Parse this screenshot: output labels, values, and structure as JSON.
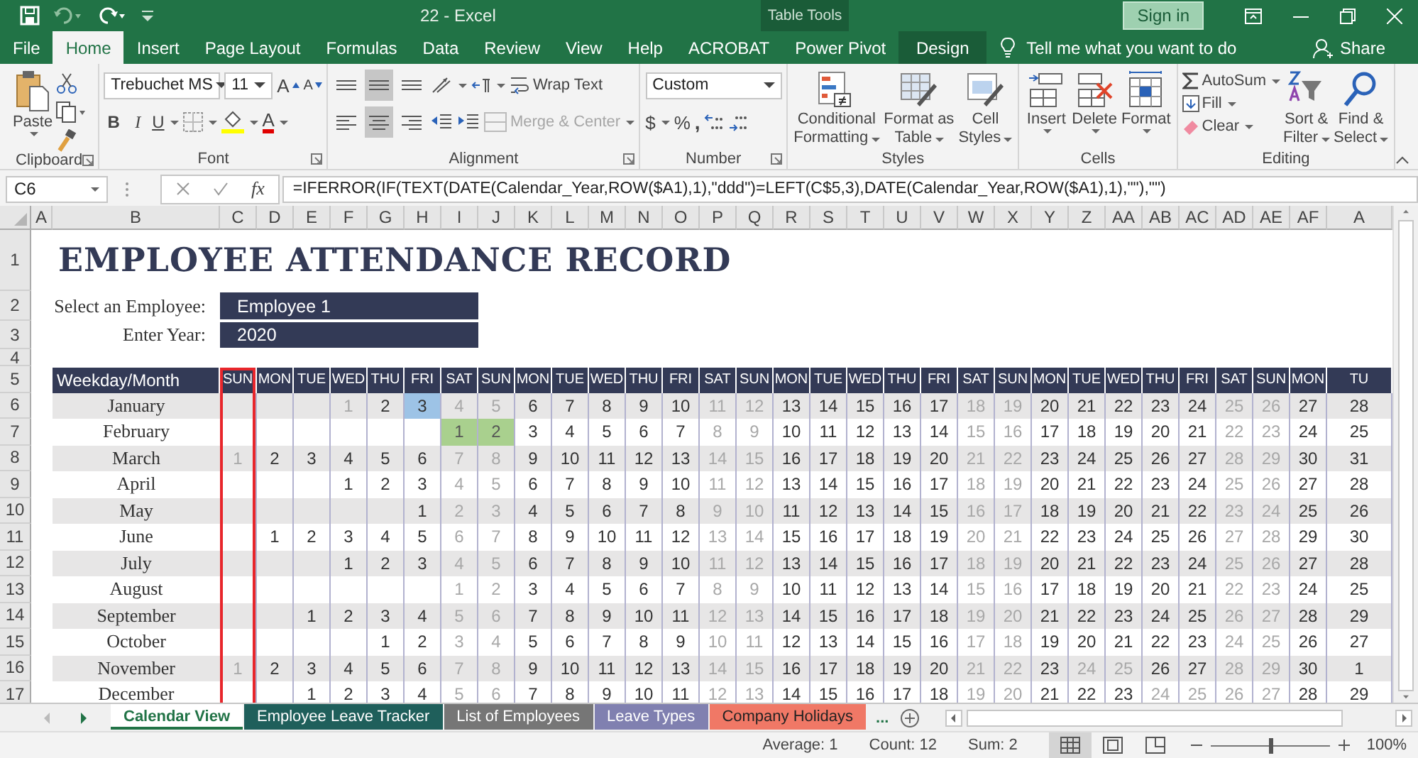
{
  "title_bar": {
    "title": "22  -  Excel",
    "context_label": "Table Tools",
    "sign_in": "Sign in"
  },
  "ribbon_tabs": [
    {
      "label": "File",
      "selected": false,
      "kind": "normal"
    },
    {
      "label": "Home",
      "selected": true,
      "kind": "normal"
    },
    {
      "label": "Insert",
      "selected": false,
      "kind": "normal"
    },
    {
      "label": "Page Layout",
      "selected": false,
      "kind": "normal"
    },
    {
      "label": "Formulas",
      "selected": false,
      "kind": "normal"
    },
    {
      "label": "Data",
      "selected": false,
      "kind": "normal"
    },
    {
      "label": "Review",
      "selected": false,
      "kind": "normal"
    },
    {
      "label": "View",
      "selected": false,
      "kind": "normal"
    },
    {
      "label": "Help",
      "selected": false,
      "kind": "normal"
    },
    {
      "label": "ACROBAT",
      "selected": false,
      "kind": "normal"
    },
    {
      "label": "Power Pivot",
      "selected": false,
      "kind": "normal"
    },
    {
      "label": "Design",
      "selected": false,
      "kind": "contextual"
    }
  ],
  "tell_me": "Tell me what you want to do",
  "share": "Share",
  "clipboard": {
    "label": "Clipboard",
    "paste": "Paste"
  },
  "font": {
    "label": "Font",
    "name": "Trebuchet MS",
    "size": "11",
    "grow": "A",
    "shrink": "A",
    "bold": "B",
    "italic": "I",
    "underline": "U",
    "color_letter": "A"
  },
  "alignment": {
    "label": "Alignment",
    "wrap_text": "Wrap Text",
    "merge": "Merge & Center",
    "merge_disabled": true,
    "buttons": [
      {
        "kind": "top",
        "selected": false
      },
      {
        "kind": "middle",
        "selected": true
      },
      {
        "kind": "bottom",
        "selected": false
      },
      {
        "kind": "left",
        "selected": false
      },
      {
        "kind": "center",
        "selected": true
      },
      {
        "kind": "right",
        "selected": false
      }
    ]
  },
  "number": {
    "label": "Number",
    "format": "Custom",
    "currency": "$",
    "percent": "%",
    "comma": ","
  },
  "styles": {
    "label": "Styles",
    "buttons": [
      {
        "kind": "conditional",
        "lines": [
          "Conditional",
          "Formatting"
        ]
      },
      {
        "kind": "table",
        "lines": [
          "Format as",
          "Table"
        ]
      },
      {
        "kind": "cell",
        "lines": [
          "Cell",
          "Styles"
        ]
      }
    ]
  },
  "cells": {
    "label": "Cells",
    "buttons": [
      {
        "kind": "insert",
        "label": "Insert"
      },
      {
        "kind": "delete",
        "label": "Delete"
      },
      {
        "kind": "format",
        "label": "Format"
      }
    ]
  },
  "editing": {
    "label": "Editing",
    "autosum": "AutoSum",
    "fill": "Fill",
    "clear": "Clear",
    "buttons": [
      {
        "kind": "sort",
        "lines": [
          "Sort &",
          "Filter"
        ]
      },
      {
        "kind": "find",
        "lines": [
          "Find &",
          "Select"
        ]
      }
    ]
  },
  "formula_bar": {
    "name_box": "C6",
    "function_label": "fx",
    "formula": "=IFERROR(IF(TEXT(DATE(Calendar_Year,ROW($A1),1),\"ddd\")=LEFT(C$5,3),DATE(Calendar_Year,ROW($A1),1),\"\"),\"\")"
  },
  "column_headers": [
    "A",
    "B",
    "C",
    "D",
    "E",
    "F",
    "G",
    "H",
    "I",
    "J",
    "K",
    "L",
    "M",
    "N",
    "O",
    "P",
    "Q",
    "R",
    "S",
    "T",
    "U",
    "V",
    "W",
    "X",
    "Y",
    "Z",
    "AA",
    "AB",
    "AC",
    "AD",
    "AE",
    "AF",
    "A"
  ],
  "row_headers": [
    "1",
    "2",
    "3",
    "4",
    "5",
    "6",
    "7",
    "8",
    "9",
    "10",
    "11",
    "12",
    "13",
    "14",
    "15",
    "16",
    "17"
  ],
  "sheet": {
    "title": "EMPLOYEE ATTENDANCE RECORD",
    "employee_label": "Select an Employee:",
    "employee": "Employee 1",
    "year_label": "Enter Year:",
    "year": "2020"
  },
  "calendar": {
    "corner": "Weekday/Month",
    "columns": [
      {
        "label": "SUN",
        "weekend": true,
        "outlined": true
      },
      {
        "label": "MON",
        "weekend": false,
        "outlined": false
      },
      {
        "label": "TUE",
        "weekend": false,
        "outlined": false
      },
      {
        "label": "WED",
        "weekend": false,
        "outlined": false
      },
      {
        "label": "THU",
        "weekend": false,
        "outlined": false
      },
      {
        "label": "FRI",
        "weekend": false,
        "outlined": false
      },
      {
        "label": "SAT",
        "weekend": true,
        "outlined": false
      },
      {
        "label": "SUN",
        "weekend": true,
        "outlined": false
      },
      {
        "label": "MON",
        "weekend": false,
        "outlined": false
      },
      {
        "label": "TUE",
        "weekend": false,
        "outlined": false
      },
      {
        "label": "WED",
        "weekend": false,
        "outlined": false
      },
      {
        "label": "THU",
        "weekend": false,
        "outlined": false
      },
      {
        "label": "FRI",
        "weekend": false,
        "outlined": false
      },
      {
        "label": "SAT",
        "weekend": true,
        "outlined": false
      },
      {
        "label": "SUN",
        "weekend": true,
        "outlined": false
      },
      {
        "label": "MON",
        "weekend": false,
        "outlined": false
      },
      {
        "label": "TUE",
        "weekend": false,
        "outlined": false
      },
      {
        "label": "WED",
        "weekend": false,
        "outlined": false
      },
      {
        "label": "THU",
        "weekend": false,
        "outlined": false
      },
      {
        "label": "FRI",
        "weekend": false,
        "outlined": false
      },
      {
        "label": "SAT",
        "weekend": true,
        "outlined": false
      },
      {
        "label": "SUN",
        "weekend": true,
        "outlined": false
      },
      {
        "label": "MON",
        "weekend": false,
        "outlined": false
      },
      {
        "label": "TUE",
        "weekend": false,
        "outlined": false
      },
      {
        "label": "WED",
        "weekend": false,
        "outlined": false
      },
      {
        "label": "THU",
        "weekend": false,
        "outlined": false
      },
      {
        "label": "FRI",
        "weekend": false,
        "outlined": false
      },
      {
        "label": "SAT",
        "weekend": true,
        "outlined": false
      },
      {
        "label": "SUN",
        "weekend": true,
        "outlined": false
      },
      {
        "label": "MON",
        "weekend": false,
        "outlined": false
      },
      {
        "label": "TU",
        "weekend": false,
        "outlined": false
      }
    ],
    "rows": [
      {
        "month": "January",
        "cells": [
          null,
          null,
          null,
          {
            "text": "1",
            "muted": true
          },
          "2",
          {
            "text": "3",
            "color": "#9dc3e6"
          },
          "4",
          "5",
          "6",
          "7",
          "8",
          "9",
          "10",
          "11",
          "12",
          "13",
          "14",
          "15",
          "16",
          "17",
          "18",
          "19",
          "20",
          "21",
          "22",
          "23",
          "24",
          "25",
          "26",
          "27",
          "28"
        ]
      },
      {
        "month": "February",
        "cells": [
          null,
          null,
          null,
          null,
          null,
          null,
          {
            "text": "1",
            "color": "#a9d08e"
          },
          {
            "text": "2",
            "color": "#a9d08e"
          },
          "3",
          "4",
          "5",
          "6",
          "7",
          "8",
          "9",
          "10",
          "11",
          "12",
          "13",
          "14",
          "15",
          "16",
          "17",
          "18",
          "19",
          "20",
          "21",
          "22",
          "23",
          "24",
          "25"
        ]
      },
      {
        "month": "March",
        "cells": [
          "1",
          "2",
          "3",
          "4",
          "5",
          "6",
          "7",
          "8",
          "9",
          "10",
          "11",
          "12",
          "13",
          "14",
          "15",
          "16",
          "17",
          "18",
          "19",
          "20",
          "21",
          "22",
          "23",
          "24",
          "25",
          "26",
          "27",
          "28",
          "29",
          "30",
          "31"
        ]
      },
      {
        "month": "April",
        "cells": [
          null,
          null,
          null,
          "1",
          "2",
          "3",
          "4",
          "5",
          "6",
          "7",
          "8",
          "9",
          "10",
          "11",
          "12",
          "13",
          "14",
          "15",
          "16",
          "17",
          "18",
          "19",
          "20",
          "21",
          "22",
          "23",
          "24",
          "25",
          "26",
          "27",
          "28"
        ]
      },
      {
        "month": "May",
        "cells": [
          null,
          null,
          null,
          null,
          null,
          "1",
          "2",
          "3",
          "4",
          "5",
          "6",
          "7",
          "8",
          "9",
          "10",
          "11",
          "12",
          "13",
          "14",
          "15",
          "16",
          "17",
          "18",
          "19",
          "20",
          "21",
          "22",
          "23",
          "24",
          "25",
          "26"
        ]
      },
      {
        "month": "June",
        "cells": [
          null,
          "1",
          "2",
          "3",
          "4",
          "5",
          "6",
          "7",
          "8",
          "9",
          "10",
          "11",
          "12",
          "13",
          "14",
          "15",
          "16",
          "17",
          "18",
          "19",
          "20",
          "21",
          "22",
          "23",
          "24",
          "25",
          "26",
          "27",
          "28",
          "29",
          "30"
        ]
      },
      {
        "month": "July",
        "cells": [
          null,
          null,
          null,
          "1",
          "2",
          "3",
          "4",
          "5",
          "6",
          "7",
          "8",
          "9",
          "10",
          "11",
          "12",
          "13",
          "14",
          "15",
          "16",
          "17",
          "18",
          "19",
          "20",
          "21",
          "22",
          "23",
          "24",
          "25",
          "26",
          "27",
          "28"
        ]
      },
      {
        "month": "August",
        "cells": [
          null,
          null,
          null,
          null,
          null,
          null,
          "1",
          "2",
          "3",
          "4",
          "5",
          "6",
          "7",
          "8",
          "9",
          "10",
          "11",
          "12",
          "13",
          "14",
          "15",
          "16",
          "17",
          "18",
          "19",
          "20",
          "21",
          "22",
          "23",
          "24",
          "25"
        ]
      },
      {
        "month": "September",
        "cells": [
          null,
          null,
          "1",
          "2",
          "3",
          "4",
          "5",
          "6",
          "7",
          "8",
          "9",
          "10",
          "11",
          "12",
          "13",
          "14",
          "15",
          "16",
          "17",
          "18",
          "19",
          "20",
          "21",
          "22",
          "23",
          "24",
          "25",
          "26",
          "27",
          "28",
          "29"
        ]
      },
      {
        "month": "October",
        "cells": [
          null,
          null,
          null,
          null,
          "1",
          "2",
          "3",
          "4",
          "5",
          "6",
          "7",
          "8",
          "9",
          "10",
          "11",
          "12",
          "13",
          "14",
          "15",
          "16",
          "17",
          "18",
          "19",
          "20",
          "21",
          "22",
          "23",
          "24",
          "25",
          "26",
          "27"
        ]
      },
      {
        "month": "November",
        "cells": [
          "1",
          "2",
          "3",
          "4",
          "5",
          "6",
          "7",
          "8",
          "9",
          "10",
          "11",
          "12",
          "13",
          "14",
          "15",
          "16",
          "17",
          "18",
          "19",
          "20",
          "21",
          "22",
          "23",
          {
            "text": "24",
            "muted": true
          },
          {
            "text": "25",
            "muted": true
          },
          "26",
          "27",
          "28",
          "29",
          "30",
          "1"
        ]
      },
      {
        "month": "December",
        "cells": [
          null,
          null,
          "1",
          "2",
          "3",
          "4",
          "5",
          "6",
          "7",
          "8",
          "9",
          "10",
          "11",
          "12",
          "13",
          "14",
          "15",
          "16",
          "17",
          "18",
          "19",
          "20",
          "21",
          "22",
          "23",
          {
            "text": "24",
            "muted": true
          },
          {
            "text": "25",
            "muted": true
          },
          "26",
          "27",
          "28",
          "29"
        ]
      }
    ]
  },
  "sheet_tabs": [
    {
      "label": "Calendar View",
      "selected": true,
      "color": "#217346"
    },
    {
      "label": "Employee Leave Tracker",
      "selected": false,
      "color": "#1f5f5b"
    },
    {
      "label": "List of Employees",
      "selected": false,
      "color": "#767676"
    },
    {
      "label": "Leave Types",
      "selected": false,
      "color": "#8080b0"
    },
    {
      "label": "Company Holidays",
      "selected": false,
      "color": "#f07866"
    }
  ],
  "more_tabs": "...",
  "status_bar": {
    "average": "Average: 1",
    "count": "Count: 12",
    "sum": "Sum: 2",
    "zoom": "100%",
    "zoom_slider": {
      "level": 0.5
    }
  }
}
